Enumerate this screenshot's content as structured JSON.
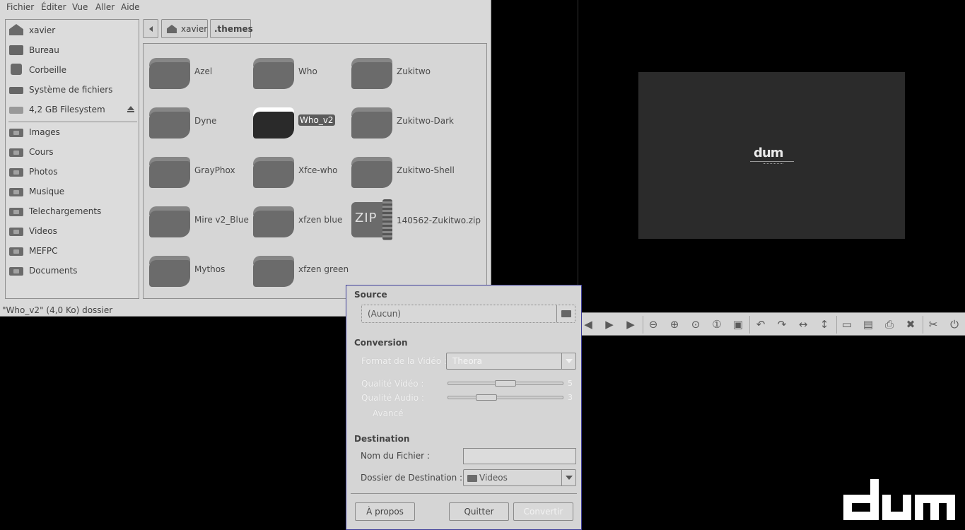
{
  "file_manager": {
    "menu": [
      "Fichier",
      "Éditer",
      "Vue",
      "Aller",
      "Aide"
    ],
    "sidebar": {
      "places": [
        {
          "label": "xavier",
          "icon": "home-icon"
        },
        {
          "label": "Bureau",
          "icon": "desktop-icon"
        },
        {
          "label": "Corbeille",
          "icon": "trash-icon"
        },
        {
          "label": "Système de fichiers",
          "icon": "drive-icon"
        },
        {
          "label": "4,2 GB Filesystem",
          "icon": "removable-drive-icon"
        }
      ],
      "bookmarks": [
        {
          "label": "Images",
          "icon": "pictures-folder-icon"
        },
        {
          "label": "Cours",
          "icon": "folder-icon"
        },
        {
          "label": "Photos",
          "icon": "folder-icon"
        },
        {
          "label": "Musique",
          "icon": "music-folder-icon"
        },
        {
          "label": "Telechargements",
          "icon": "download-folder-icon"
        },
        {
          "label": "Videos",
          "icon": "videos-folder-icon"
        },
        {
          "label": "MEFPC",
          "icon": "folder-icon"
        },
        {
          "label": "Documents",
          "icon": "documents-folder-icon"
        }
      ]
    },
    "path": [
      "xavier",
      ".themes"
    ],
    "items": [
      {
        "label": "Azel",
        "type": "folder"
      },
      {
        "label": "Who",
        "type": "folder"
      },
      {
        "label": "Zukitwo",
        "type": "folder"
      },
      {
        "label": "Dyne",
        "type": "folder"
      },
      {
        "label": "Who_v2",
        "type": "folder",
        "selected": true
      },
      {
        "label": "Zukitwo-Dark",
        "type": "folder"
      },
      {
        "label": "GrayPhox",
        "type": "folder"
      },
      {
        "label": "Xfce-who",
        "type": "folder"
      },
      {
        "label": "Zukitwo-Shell",
        "type": "folder"
      },
      {
        "label": "Mire v2_Blue",
        "type": "folder"
      },
      {
        "label": "xfzen blue",
        "type": "folder"
      },
      {
        "label": "140562-Zukitwo.zip",
        "type": "zip",
        "icon_text": "ZIP"
      },
      {
        "label": "Mythos",
        "type": "folder"
      },
      {
        "label": "xfzen green",
        "type": "folder"
      }
    ],
    "status": "\"Who_v2\" (4,0 Ko) dossier"
  },
  "viewer": {
    "preview_logo": "dum",
    "toolbar_icons": [
      "prev-icon",
      "next-icon",
      "play-icon",
      "zoom-out-icon",
      "zoom-in-icon",
      "zoom-fit-icon",
      "zoom-100-icon",
      "fullscreen-icon",
      "rotate-left-icon",
      "rotate-right-icon",
      "flip-horizontal-icon",
      "flip-vertical-icon",
      "open-icon",
      "save-icon",
      "print-icon",
      "delete-icon",
      "tools-icon",
      "quit-icon"
    ]
  },
  "converter": {
    "source_title": "Source",
    "source_value": "(Aucun)",
    "conversion_title": "Conversion",
    "format_label": "Format de la Vidéo :",
    "format_value": "Theora",
    "video_quality_label": "Qualité Vidéo :",
    "video_quality_value": "5",
    "audio_quality_label": "Qualité Audio :",
    "audio_quality_value": "3",
    "advanced_label": "Avancé",
    "destination_title": "Destination",
    "filename_label": "Nom du Fichier :",
    "filename_value": "",
    "dest_folder_label": "Dossier de Destination :",
    "dest_folder_value": "Videos",
    "about_button": "À propos",
    "quit_button": "Quitter",
    "convert_button": "Convertir"
  }
}
